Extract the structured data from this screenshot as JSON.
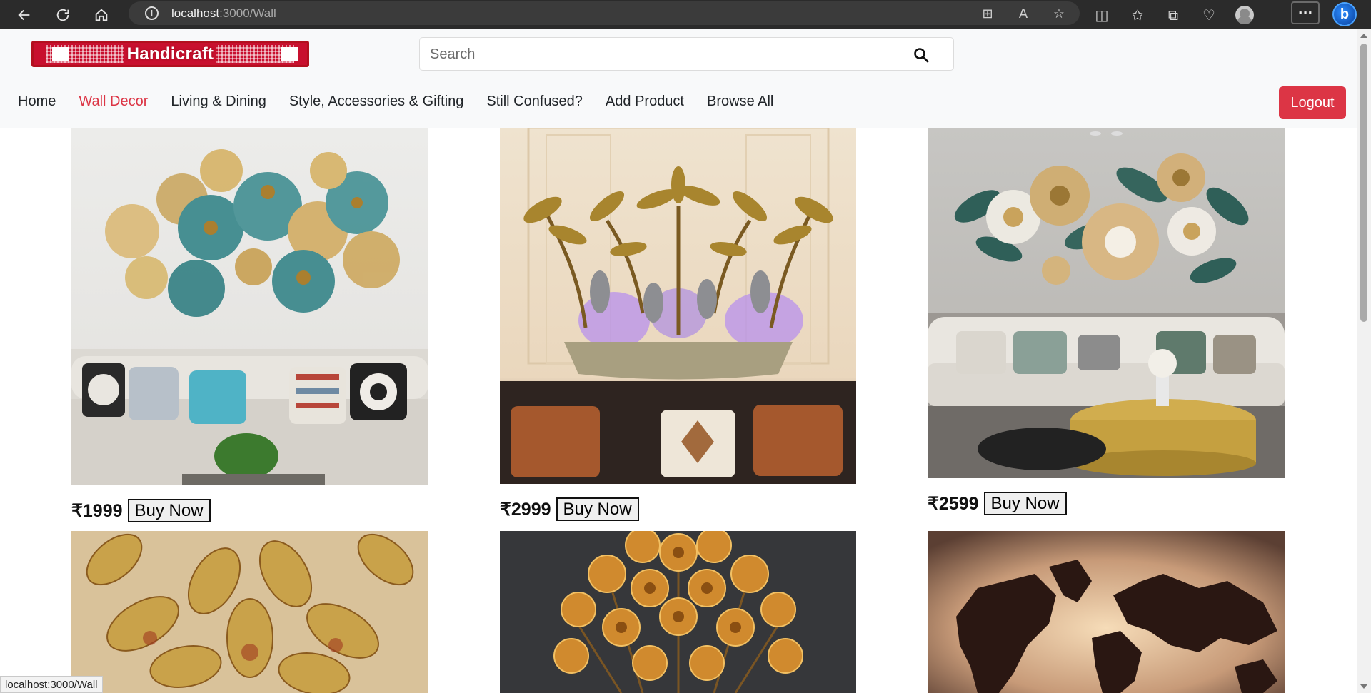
{
  "browser": {
    "url_host": "localhost",
    "url_path": ":3000/Wall",
    "icons": [
      "back-icon",
      "refresh-icon",
      "home-icon",
      "site-info-icon",
      "apps-icon",
      "read-aloud-icon",
      "favorite-star-icon",
      "split-screen-icon",
      "favorites-icon",
      "collections-icon",
      "performance-icon",
      "profile-icon",
      "more-icon",
      "copilot-icon"
    ],
    "more_label": "···",
    "copilot_label": "b"
  },
  "header": {
    "brand": "Handicraft",
    "search_placeholder": "Search",
    "menu": [
      {
        "label": "Home",
        "active": false
      },
      {
        "label": "Wall Decor",
        "active": true
      },
      {
        "label": "Living & Dining",
        "active": false
      },
      {
        "label": "Style, Accessories & Gifting",
        "active": false
      },
      {
        "label": "Still Confused?",
        "active": false
      },
      {
        "label": "Add Product",
        "active": false
      },
      {
        "label": "Browse All",
        "active": false
      }
    ],
    "logout_label": "Logout"
  },
  "products": [
    {
      "price": "₹1999",
      "buy_label": "Buy Now"
    },
    {
      "price": "₹2999",
      "buy_label": "Buy Now"
    },
    {
      "price": "₹2599",
      "buy_label": "Buy Now"
    }
  ],
  "status_url": "localhost:3000/Wall",
  "colors": {
    "accent": "#dc3545",
    "navbar_bg": "#f8f9fa",
    "brand_red": "#c8102e"
  }
}
